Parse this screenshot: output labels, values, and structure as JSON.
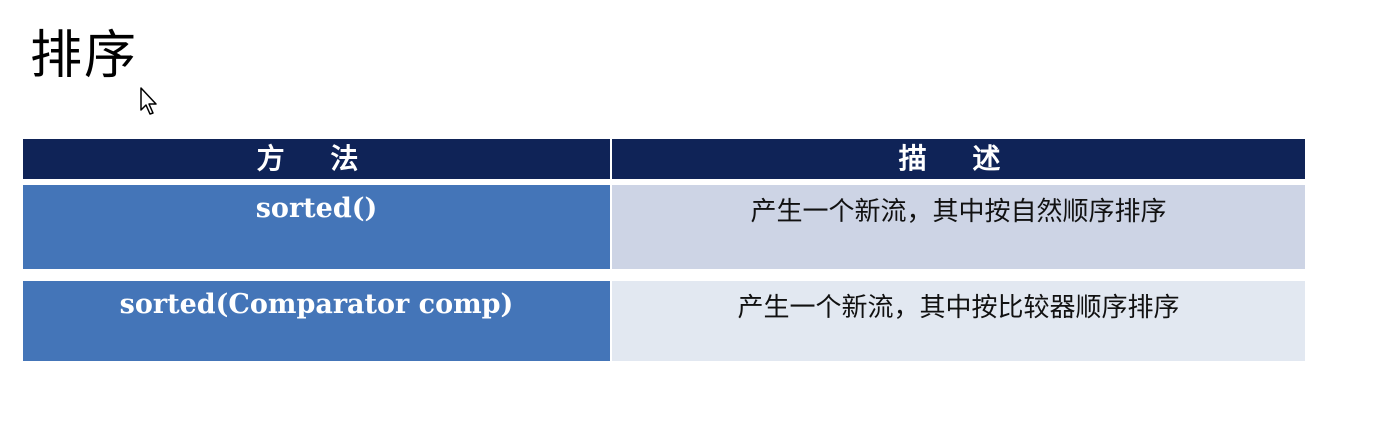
{
  "page": {
    "title": "排序"
  },
  "table": {
    "headers": {
      "method": "方 法",
      "description": "描 述"
    },
    "rows": [
      {
        "method": "sorted()",
        "description": "产生一个新流，其中按自然顺序排序"
      },
      {
        "method": "sorted(Comparator comp)",
        "description": "产生一个新流，其中按比较器顺序排序"
      }
    ]
  },
  "colors": {
    "header_bg": "#0f2357",
    "method_cell_bg": "#4475b8",
    "desc_row1_bg": "#cdd4e5",
    "desc_row2_bg": "#e2e8f1"
  },
  "icons": {
    "cursor": "mouse-pointer-icon"
  }
}
